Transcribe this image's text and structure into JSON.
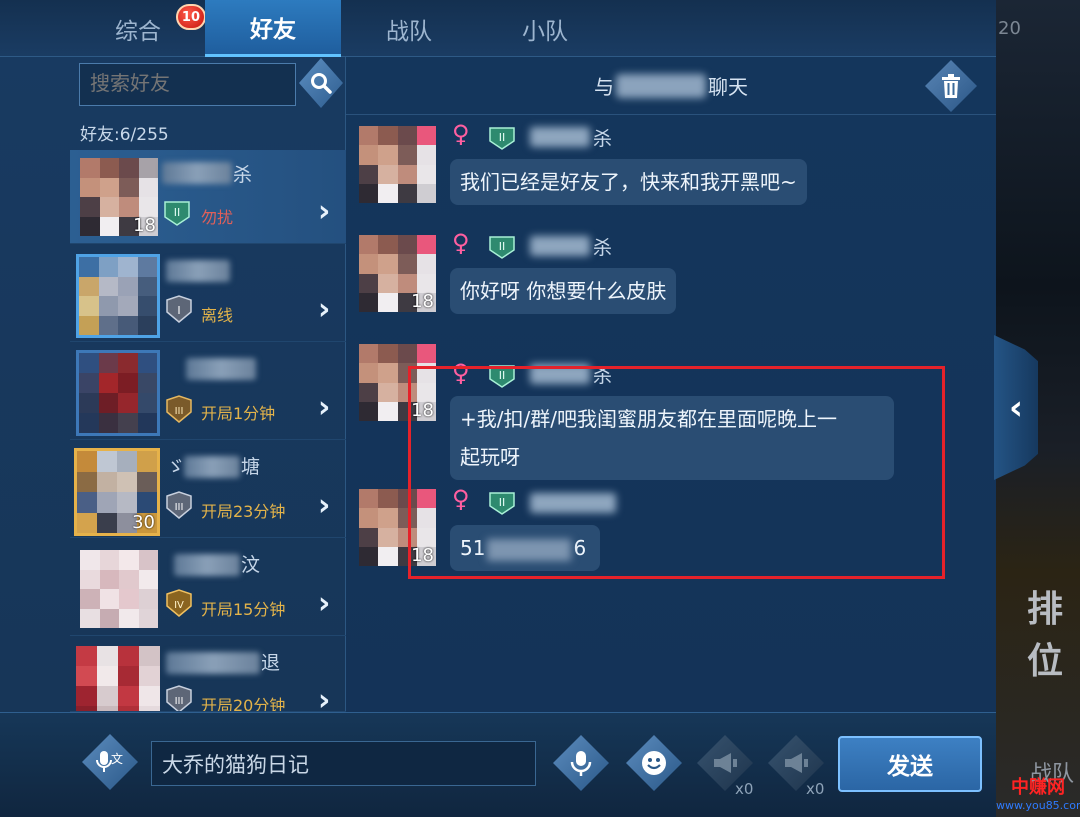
{
  "tabs": [
    {
      "label": "综合",
      "badge": "10"
    },
    {
      "label": "好友",
      "active": true
    },
    {
      "label": "战队"
    },
    {
      "label": "小队"
    }
  ],
  "search": {
    "placeholder": "搜索好友"
  },
  "friend_count": "好友:6/255",
  "friends": [
    {
      "name_tail": "杀",
      "level": "18",
      "status": "勿扰",
      "status_color": "#e0605a"
    },
    {
      "name_tail": "",
      "level": "",
      "status": "离线",
      "status_color": "#e3b34a"
    },
    {
      "name_tail": "",
      "level": "",
      "status": "开局1分钟",
      "status_color": "#e3b34a"
    },
    {
      "name_tail": "塘",
      "level": "30",
      "status": "开局23分钟",
      "status_color": "#e3b34a"
    },
    {
      "name_tail": "汶",
      "level": "",
      "status": "开局15分钟",
      "status_color": "#e3b34a"
    },
    {
      "name_tail": "退",
      "level": "",
      "status": "开局20分钟",
      "status_color": "#e3b34a"
    }
  ],
  "chat": {
    "header_prefix": "与",
    "header_suffix": "聊天",
    "messages": [
      {
        "gender": "♀",
        "name_tail": "杀",
        "text": "我们已经是好友了，快来和我开黑吧~",
        "level": "18"
      },
      {
        "gender": "♀",
        "name_tail": "杀",
        "text": "你好呀 你想要什么皮肤",
        "level": "18"
      },
      {
        "gender": "♀",
        "name_tail": "杀",
        "text_line1": "+我/扣/群/吧我闺蜜朋友都在里面呢晚上一",
        "text_line2": "起玩呀",
        "level": "18"
      },
      {
        "gender": "♀",
        "name_tail": "",
        "text_start": "51",
        "text_end": "6",
        "level": "18"
      }
    ]
  },
  "input": {
    "value": "大乔的猫狗日记"
  },
  "send_label": "发送",
  "horn_counts": [
    "x0",
    "x0"
  ],
  "background": {
    "num": "20",
    "rank_text": "排位",
    "bottom_text": "战队"
  },
  "watermark": {
    "line1": "中赚网",
    "line2": "www.you85.com"
  },
  "colors": {
    "accent": "#2d7bbf",
    "highlight_box": "#e5222a",
    "gender": "#ff5fa0"
  }
}
